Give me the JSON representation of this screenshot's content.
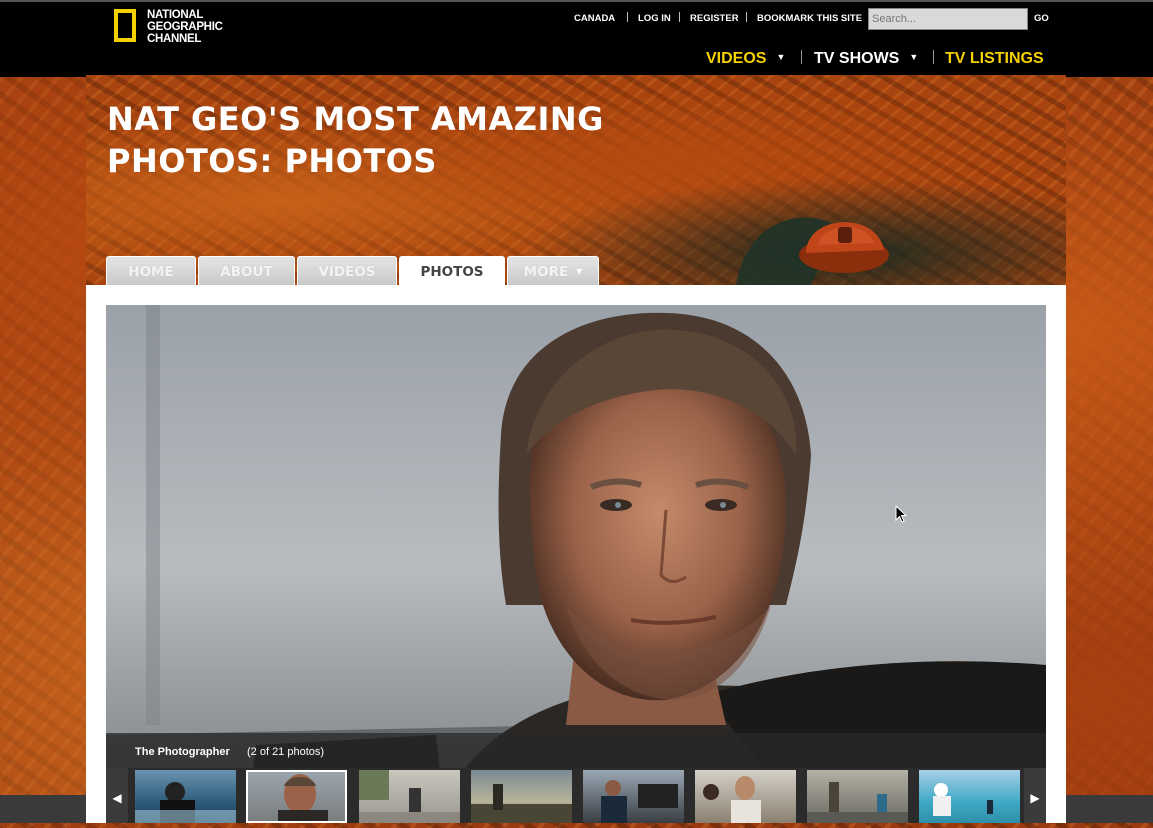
{
  "brand": {
    "logo_lines": [
      "NATIONAL",
      "GEOGRAPHIC",
      "CHANNEL"
    ],
    "accent_color": "#f5d100"
  },
  "utility_nav": {
    "items": [
      "CANADA",
      "LOG IN",
      "REGISTER",
      "BOOKMARK THIS SITE"
    ],
    "search_placeholder": "Search...",
    "go_label": "GO"
  },
  "main_nav": {
    "videos": "VIDEOS",
    "tv_shows": "TV SHOWS",
    "tv_listings": "TV LISTINGS",
    "videos_color": "#f5d100",
    "tv_shows_color": "#ffffff",
    "tv_listings_color": "#f5d100"
  },
  "page": {
    "title_line1": "NAT GEO'S MOST AMAZING",
    "title_line2": "PHOTOS: PHOTOS"
  },
  "tabs": [
    {
      "label": "HOME",
      "active": false
    },
    {
      "label": "ABOUT",
      "active": false
    },
    {
      "label": "VIDEOS",
      "active": false
    },
    {
      "label": "PHOTOS",
      "active": true
    },
    {
      "label": "MORE",
      "active": false
    }
  ],
  "gallery": {
    "caption_title": "The Photographer",
    "caption_count": "(2 of 21 photos)",
    "current_index": 2,
    "total": 21,
    "prev_icon": "chevron-left-icon",
    "next_icon": "chevron-right-icon"
  }
}
